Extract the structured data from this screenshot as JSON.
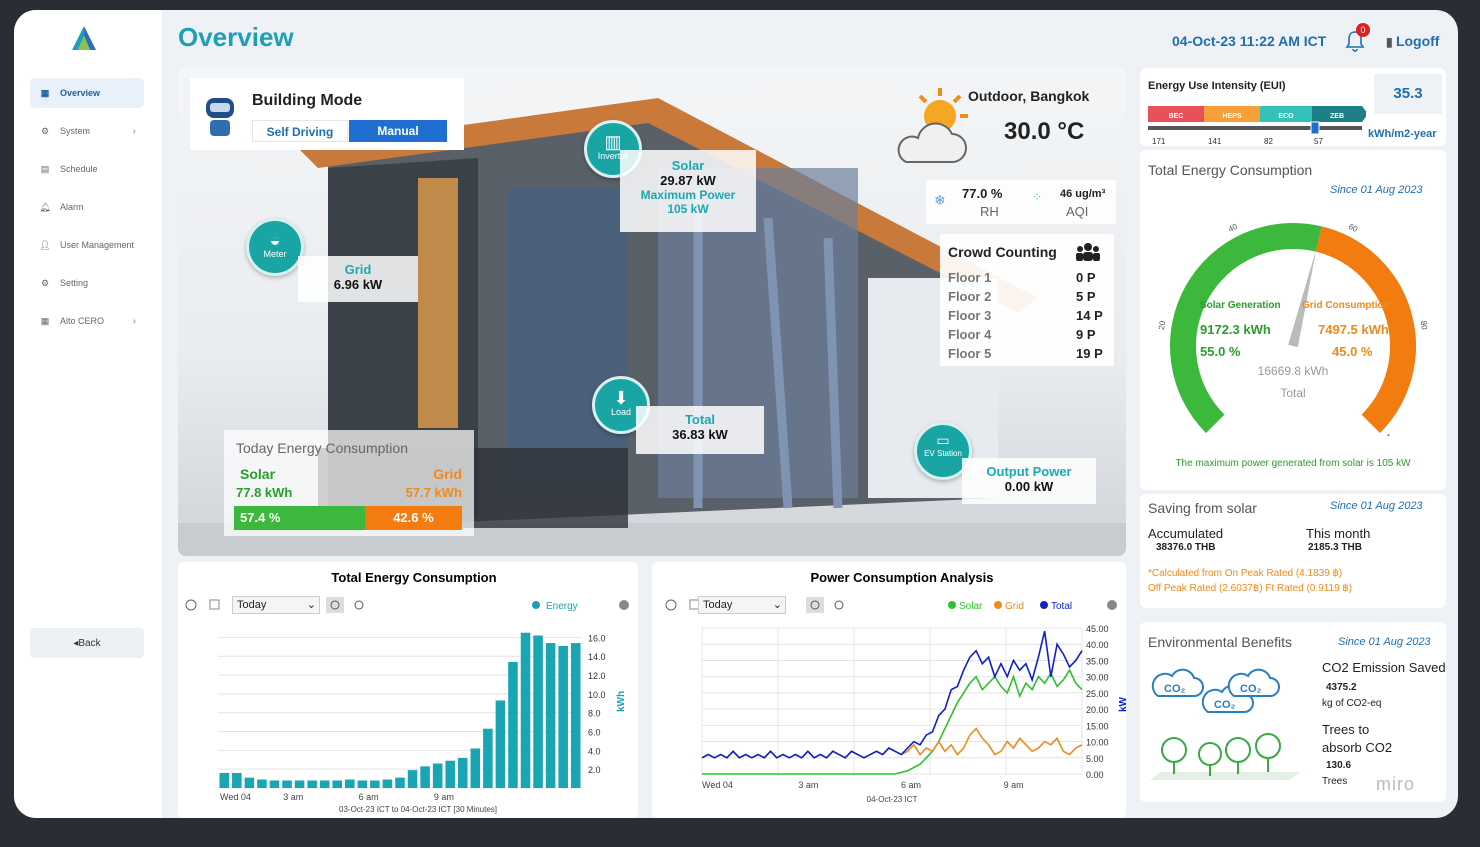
{
  "header": {
    "title": "Overview",
    "datetime": "04-Oct-23 11:22 AM ICT",
    "notif_count": "0",
    "logoff": "Logoff"
  },
  "sidebar": {
    "items": [
      {
        "label": "Overview"
      },
      {
        "label": "System"
      },
      {
        "label": "Schedule"
      },
      {
        "label": "Alarm"
      },
      {
        "label": "User Management"
      },
      {
        "label": "Setting"
      },
      {
        "label": "Alto CERO"
      }
    ],
    "back": "Back"
  },
  "building_mode": {
    "title": "Building Mode",
    "self_driving": "Self Driving",
    "manual": "Manual"
  },
  "weather": {
    "location": "Outdoor, Bangkok",
    "temp": "30.0 °C",
    "rh_value": "77.0 %",
    "rh_label": "RH",
    "aqi_value": "46 ug/m³",
    "aqi_label": "AQI"
  },
  "nodes": {
    "inverter": "Inverter",
    "solar_title": "Solar",
    "solar_value": "29.87 kW",
    "solar_max_label": "Maximum Power",
    "solar_max_value": "105 kW",
    "meter": "Meter",
    "grid_title": "Grid",
    "grid_value": "6.96 kW",
    "load": "Load",
    "total_title": "Total",
    "total_value": "36.83 kW",
    "ev": "EV Station",
    "output_title": "Output Power",
    "output_value": "0.00 kW"
  },
  "crowd": {
    "title": "Crowd Counting",
    "floors": [
      {
        "name": "Floor 1",
        "count": "0 P"
      },
      {
        "name": "Floor 2",
        "count": "5 P"
      },
      {
        "name": "Floor 3",
        "count": "14 P"
      },
      {
        "name": "Floor 4",
        "count": "9 P"
      },
      {
        "name": "Floor 5",
        "count": "19 P"
      }
    ]
  },
  "today": {
    "title": "Today Energy Consumption",
    "solar_label": "Solar",
    "solar_value": "77.8 kWh",
    "grid_label": "Grid",
    "grid_value": "57.7 kWh",
    "solar_pct": "57.4 %",
    "grid_pct": "42.6 %",
    "solar_fraction": 0.574
  },
  "eui": {
    "title": "Energy Use Intensity (EUI)",
    "value": "35.3",
    "unit": "kWh/m2-year",
    "bands": [
      "BEC",
      "HEPS",
      "ECO",
      "ZEB"
    ],
    "ticks": [
      "171",
      "141",
      "82",
      "57"
    ],
    "colors": [
      "#e8505b",
      "#f5a03a",
      "#34c2b8",
      "#1f7f86"
    ]
  },
  "total_energy": {
    "title": "Total Energy Consumption",
    "since": "Since 01 Aug 2023",
    "solar_label": "Solar Generation",
    "solar_kwh": "9172.3 kWh",
    "solar_pct": "55.0 %",
    "grid_label": "Grid Consumption",
    "grid_kwh": "7497.5 kWh",
    "grid_pct": "45.0 %",
    "total_kwh": "16669.8 kWh",
    "total_label": "Total",
    "ticks": [
      "0",
      "20",
      "40",
      "60",
      "80",
      "100"
    ],
    "note": "The maximum power generated from solar is 105 kW",
    "solar_fraction": 0.55
  },
  "saving": {
    "title": "Saving from solar",
    "since": "Since 01 Aug 2023",
    "acc_label": "Accumulated",
    "acc_value": "38376.0 THB",
    "month_label": "This month",
    "month_value": "2185.3 THB",
    "note1": "*Calculated from On Peak Rated (4.1839 ฿)",
    "note2": "Off Peak Rated (2.6037฿) Ft Rated (0.9119 ฿)"
  },
  "env": {
    "title": "Environmental Benefits",
    "since": "Since 01 Aug 2023",
    "co2_title": "CO2 Emission Saved",
    "co2_value": "4375.2",
    "co2_unit": "kg of CO2-eq",
    "trees_title1": "Trees to",
    "trees_title2": "absorb CO2",
    "trees_value": "130.6",
    "trees_unit": "Trees",
    "co2_icon": "CO₂",
    "watermark": "miro"
  },
  "chart_data": [
    {
      "type": "bar",
      "title": "Total Energy Consumption",
      "range_select": "Today",
      "legend": [
        "Energy"
      ],
      "ylabel": "kWh",
      "ylim": [
        0,
        17
      ],
      "yticks": [
        "2.0",
        "4.0",
        "6.0",
        "8.0",
        "10.0",
        "12.0",
        "14.0",
        "16.0"
      ],
      "xticks": [
        "Wed 04",
        "3 am",
        "6 am",
        "9 am"
      ],
      "footer": "03-Oct-23 ICT to 04-Oct-23 ICT   [30 Minutes]",
      "values": [
        1.6,
        1.6,
        1.1,
        0.9,
        0.8,
        0.8,
        0.8,
        0.8,
        0.8,
        0.8,
        0.9,
        0.8,
        0.8,
        0.9,
        1.1,
        1.9,
        2.3,
        2.6,
        2.9,
        3.2,
        4.2,
        6.3,
        9.3,
        13.4,
        16.5,
        16.2,
        15.4,
        15.1,
        15.4
      ]
    },
    {
      "type": "line",
      "title": "Power Consumption Analysis",
      "range_select": "Today",
      "legend": [
        "Solar",
        "Grid",
        "Total"
      ],
      "ylabel": "kW",
      "ylim": [
        0,
        45
      ],
      "yticks": [
        "0.00",
        "5.00",
        "10.00",
        "15.00",
        "20.00",
        "25.00",
        "30.00",
        "35.00",
        "40.00",
        "45.00"
      ],
      "xticks": [
        "Wed 04",
        "3 am",
        "6 am",
        "9 am"
      ],
      "footer": "04-Oct-23 ICT",
      "series": [
        {
          "name": "Solar",
          "color": "#2ec02e",
          "values": [
            0,
            0,
            0,
            0,
            0,
            0,
            0,
            0,
            0,
            0,
            0,
            0,
            0,
            0,
            0,
            0,
            0,
            0,
            0,
            0,
            0,
            0,
            0,
            0,
            0,
            0,
            0,
            0,
            0,
            0,
            0,
            0,
            0.5,
            1,
            2,
            3,
            5,
            7,
            10,
            14,
            18,
            22,
            25,
            28,
            30,
            26,
            28,
            30,
            27,
            25,
            30,
            24,
            28,
            26,
            30,
            28,
            31,
            27,
            29,
            32,
            28,
            26
          ]
        },
        {
          "name": "Grid",
          "color": "#f08a1c",
          "values": [
            5,
            6,
            5,
            6,
            5,
            7,
            5,
            6,
            5,
            6,
            5,
            7,
            5,
            6,
            5,
            6,
            5,
            7,
            5,
            6,
            5,
            7,
            6,
            5,
            7,
            6,
            5,
            6,
            7,
            6,
            8,
            7,
            6,
            7,
            9,
            6,
            8,
            7,
            10,
            7,
            9,
            6,
            8,
            12,
            14,
            11,
            9,
            6,
            7,
            10,
            8,
            11,
            9,
            7,
            8,
            10,
            9,
            11,
            7,
            6,
            8,
            9
          ]
        },
        {
          "name": "Total",
          "color": "#1020c8",
          "values": [
            5,
            6,
            5,
            6,
            5,
            7,
            5,
            6,
            5,
            6,
            5,
            7,
            5,
            6,
            5,
            6,
            5,
            7,
            5,
            6,
            5,
            7,
            6,
            5,
            7,
            6,
            5,
            6,
            7,
            6,
            8,
            7,
            6,
            8,
            10,
            9,
            12,
            13,
            18,
            20,
            26,
            27,
            32,
            36,
            38,
            34,
            36,
            30,
            34,
            30,
            35,
            32,
            34,
            29,
            36,
            44,
            30,
            40,
            37,
            33,
            35,
            38
          ]
        }
      ]
    }
  ]
}
